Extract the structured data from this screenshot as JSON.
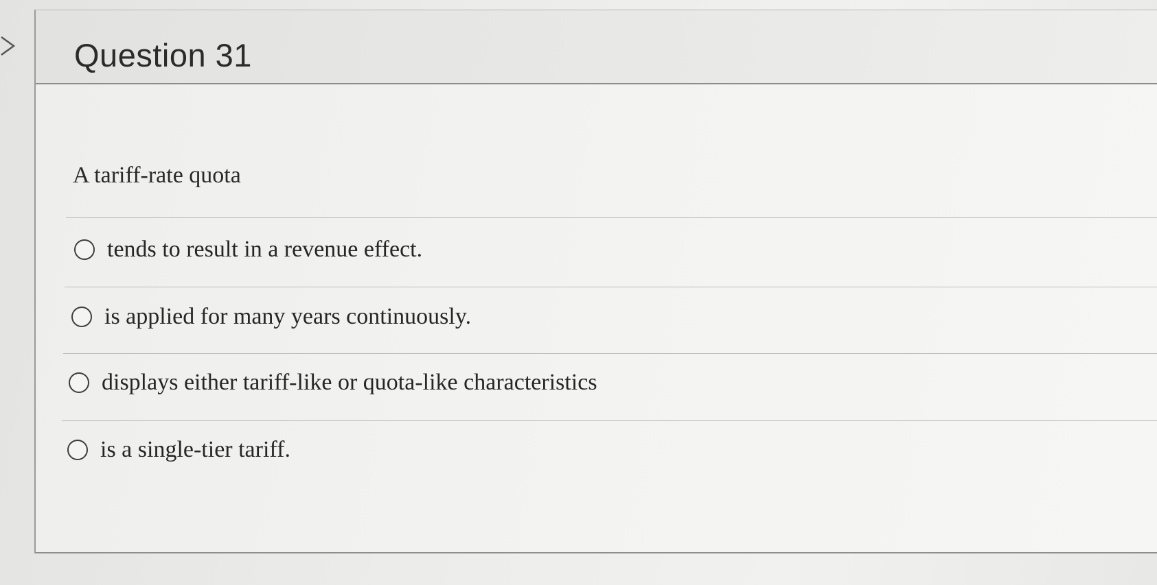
{
  "question": {
    "title": "Question 31",
    "prompt": "A tariff-rate quota"
  },
  "answers": [
    {
      "label": "tends to result in a revenue effect.",
      "selected": false
    },
    {
      "label": "is applied for many years continuously.",
      "selected": false
    },
    {
      "label": "displays either tariff-like or quota-like characteristics",
      "selected": false
    },
    {
      "label": "is a single-tier tariff.",
      "selected": false
    }
  ],
  "icons": {
    "left_nav": "chevron-right-icon",
    "radio": "radio-unselected-icon"
  }
}
